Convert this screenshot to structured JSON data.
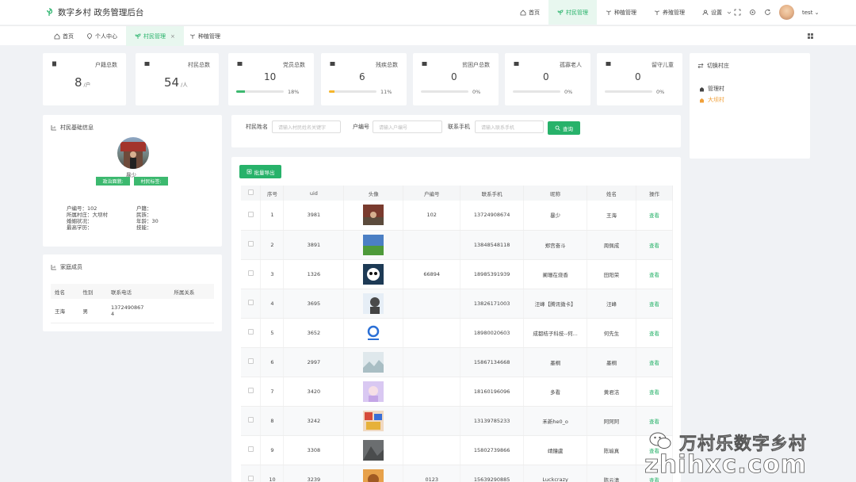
{
  "app": {
    "title": "数字乡村 政务管理后台"
  },
  "top_nav": [
    {
      "label": "首页",
      "icon": "home-icon"
    },
    {
      "label": "村民管理",
      "icon": "leaf-icon",
      "active": true
    },
    {
      "label": "种植管理",
      "icon": "sprout-icon"
    },
    {
      "label": "养殖管理",
      "icon": "sprout-icon"
    },
    {
      "label": "设置",
      "icon": "user-settings-icon"
    }
  ],
  "user": {
    "name": "test"
  },
  "tabs": [
    {
      "label": "首页",
      "icon": "home-icon"
    },
    {
      "label": "个人中心",
      "icon": "location-icon"
    },
    {
      "label": "村民管理",
      "icon": "leaf-icon",
      "active": true,
      "close": "×"
    },
    {
      "label": "种植管理",
      "icon": "sprout-icon"
    }
  ],
  "stats": [
    {
      "title": "户籍总数",
      "value": "8",
      "unit": "/户"
    },
    {
      "title": "村民总数",
      "value": "54",
      "unit": "/人"
    },
    {
      "title": "党员总数",
      "value": "10",
      "percent": "18%",
      "progress": 0.18,
      "color": "#3cb96f"
    },
    {
      "title": "残疾总数",
      "value": "6",
      "percent": "11%",
      "progress": 0.11,
      "color": "#f5b62c"
    },
    {
      "title": "贫困户总数",
      "value": "0",
      "percent": "0%",
      "progress": 0
    },
    {
      "title": "孤寡老人",
      "value": "0",
      "percent": "0%",
      "progress": 0
    },
    {
      "title": "留守儿童",
      "value": "0",
      "percent": "0%",
      "progress": 0
    }
  ],
  "switch_village": {
    "title": "切换村庄",
    "villages": [
      {
        "name": "管理村",
        "color": "#444"
      },
      {
        "name": "大坝村",
        "color": "#f0a03a"
      }
    ]
  },
  "profile": {
    "title": "村民基础信息",
    "name": "暴少",
    "tags": [
      "政治面貌:",
      "村民标签:"
    ],
    "info": {
      "hu_number": "户编号：102",
      "village": "所属村庄：大坝村",
      "marital": "婚姻状况：",
      "education": "最高学历：",
      "huji": "户籍：",
      "ethnic": "民族：",
      "age": "年龄：30",
      "skill": "技能："
    }
  },
  "family": {
    "title": "家庭成员",
    "columns": [
      "姓名",
      "性别",
      "联系电话",
      "所属关系"
    ],
    "rows": [
      {
        "name": "王海",
        "gender": "男",
        "phone_a": "1372490867",
        "phone_b": "4",
        "relation": ""
      }
    ]
  },
  "search": {
    "name_label": "村民姓名",
    "name_placeholder": "请输入村民姓名关键字",
    "hu_label": "户编号",
    "hu_placeholder": "请输入户编号",
    "phone_label": "联系手机",
    "phone_placeholder": "请输入联系手机",
    "query_button": "查询"
  },
  "export_button": "批量导出",
  "table": {
    "columns": [
      "序号",
      "uid",
      "头像",
      "户编号",
      "联系手机",
      "昵称",
      "姓名",
      "操作"
    ],
    "action_label": "查看",
    "rows": [
      {
        "idx": "1",
        "uid": "3981",
        "hu": "102",
        "phone": "13724908674",
        "nick": "暴少",
        "name": "王海"
      },
      {
        "idx": "2",
        "uid": "3891",
        "hu": "",
        "phone": "13848548118",
        "nick": "郑宫奋斗",
        "name": "周佩成"
      },
      {
        "idx": "3",
        "uid": "1326",
        "hu": "66894",
        "phone": "18985391939",
        "nick": "阑珊在烧香",
        "name": "田阳荣"
      },
      {
        "idx": "4",
        "uid": "3695",
        "hu": "",
        "phone": "13826171003",
        "nick": "汪峰【腾讯微卡】",
        "name": "汪峰"
      },
      {
        "idx": "5",
        "uid": "3652",
        "hu": "",
        "phone": "18980020603",
        "nick": "成都桔子科技--何...",
        "name": "何先生"
      },
      {
        "idx": "6",
        "uid": "2997",
        "hu": "",
        "phone": "15867134668",
        "nick": "墨桐",
        "name": "墨桐"
      },
      {
        "idx": "7",
        "uid": "3420",
        "hu": "",
        "phone": "18160196096",
        "nick": "多看",
        "name": "黄君洁"
      },
      {
        "idx": "8",
        "uid": "3242",
        "hu": "",
        "phone": "13139785233",
        "nick": "禾新he0_o",
        "name": "阿阿阿"
      },
      {
        "idx": "9",
        "uid": "3308",
        "hu": "",
        "phone": "15802739866",
        "nick": "靖鐘盧",
        "name": "陈瑜真"
      },
      {
        "idx": "10",
        "uid": "3239",
        "hu": "0123",
        "phone": "15639290885",
        "nick": "Luckcrazy",
        "name": "陈云清"
      }
    ]
  },
  "watermark": {
    "line1": "万村乐数字乡村",
    "line2": "zhihxc.com"
  },
  "colors": {
    "accent": "#27b26a",
    "active_bg": "#e8f7ef",
    "warning": "#f5b62c"
  }
}
